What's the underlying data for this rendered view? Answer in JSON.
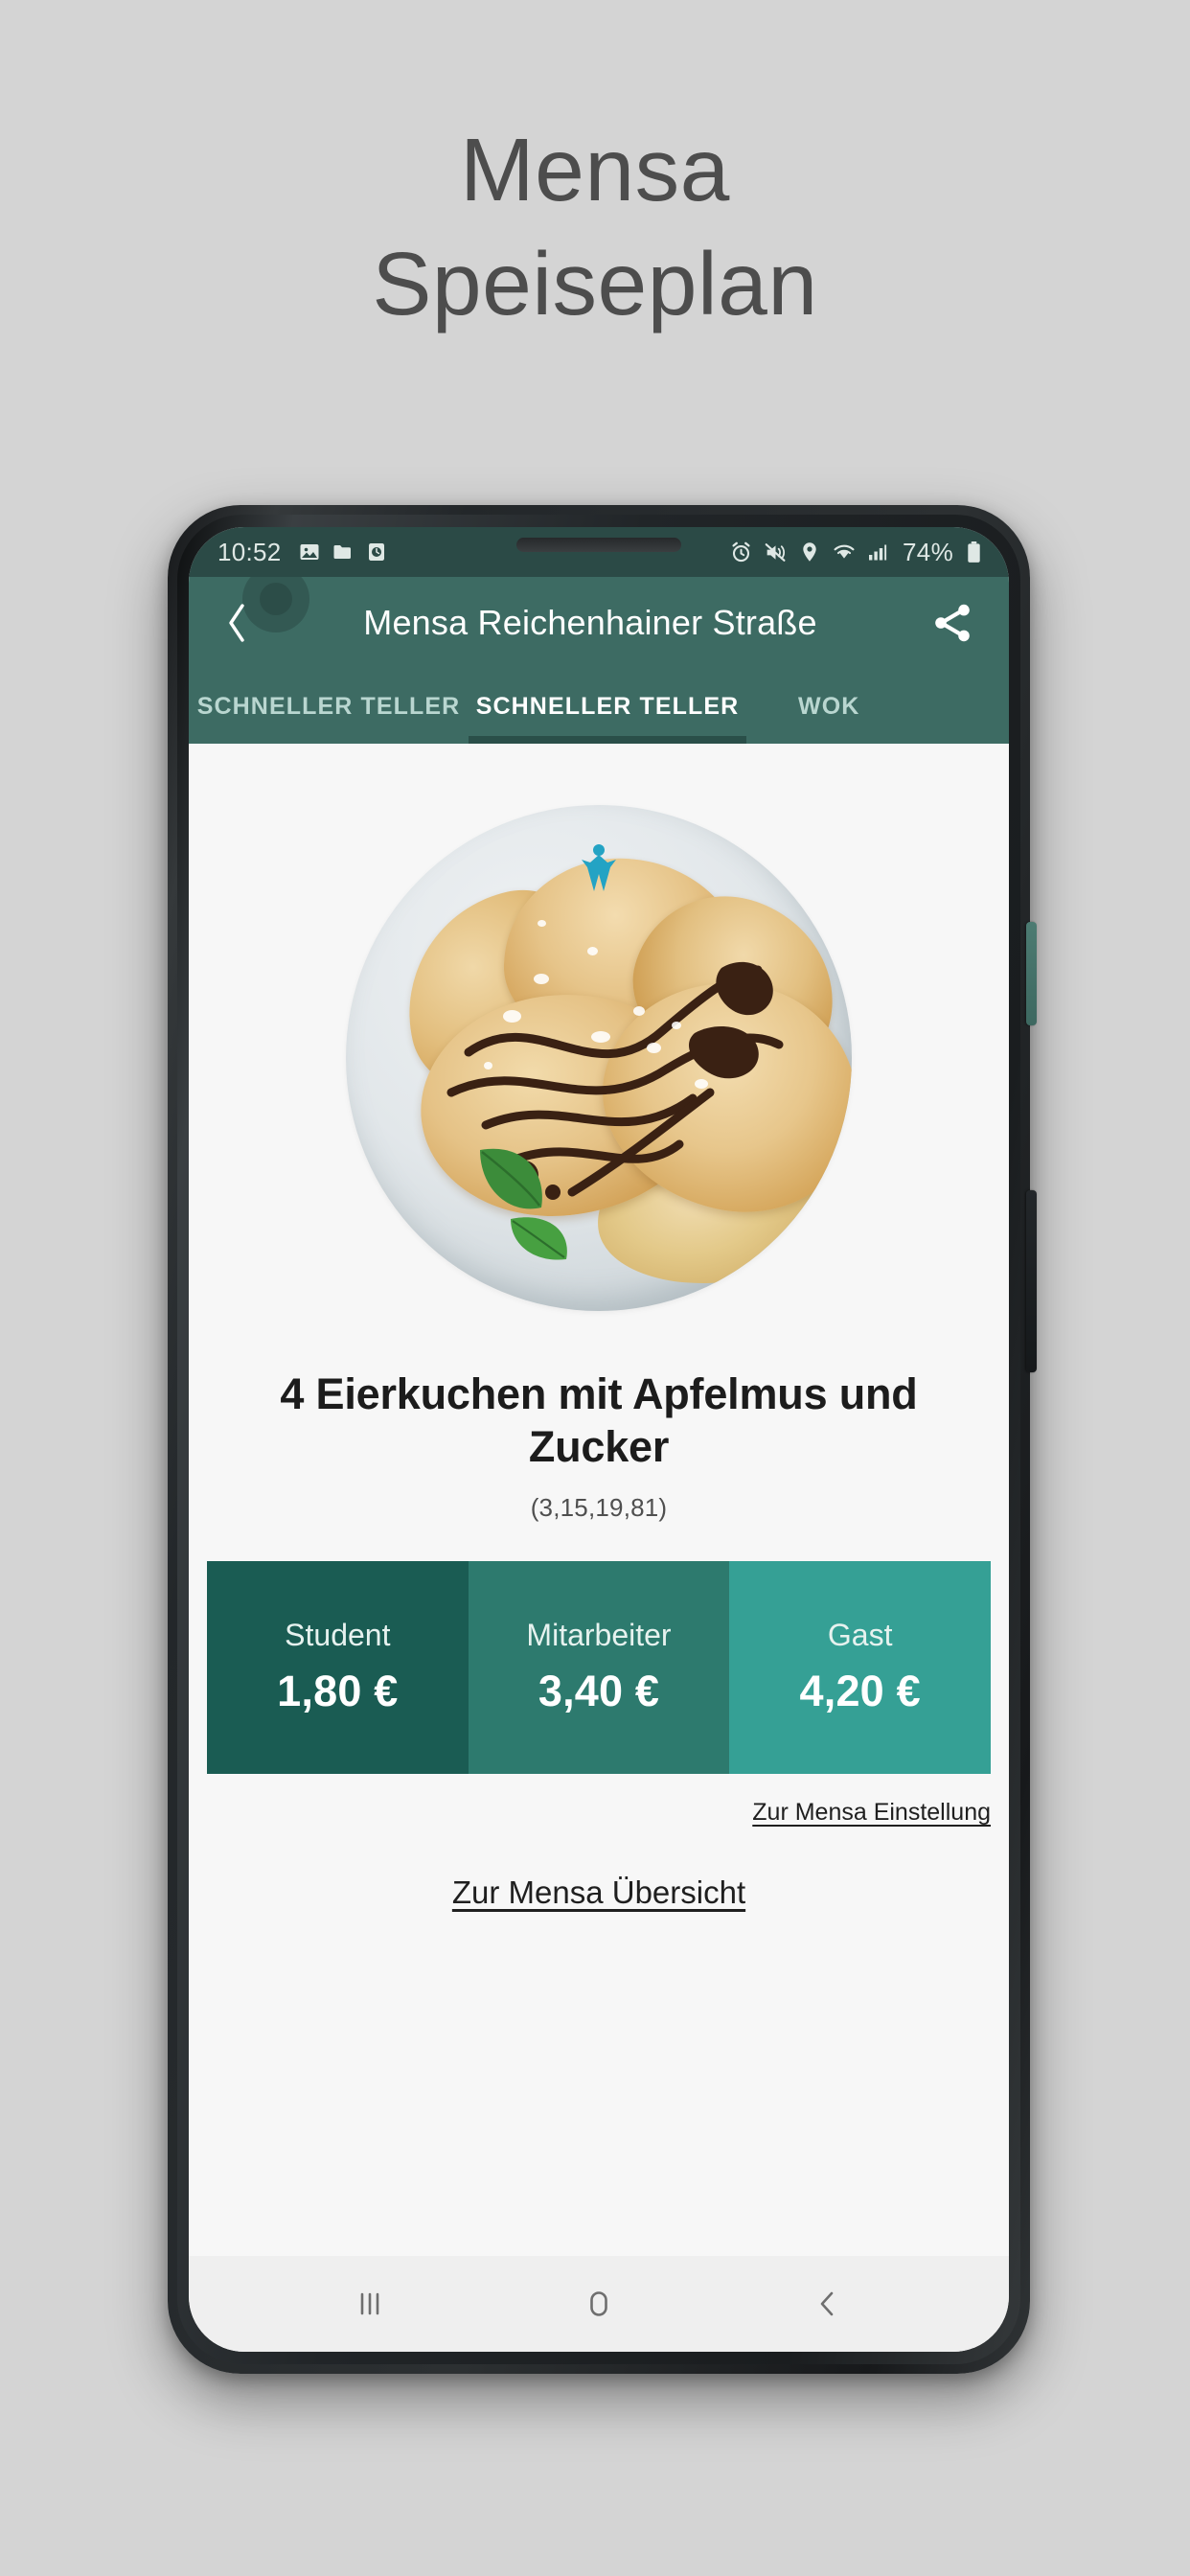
{
  "page": {
    "heading_line1": "Mensa",
    "heading_line2": "Speiseplan",
    "background_color": "#d4d4d4",
    "heading_color": "#4d4d4d"
  },
  "phone": {
    "hardware": {
      "bixby_button": "bixby-button",
      "power_button": "power-button",
      "earpiece": "earpiece-speaker",
      "camera": "front-camera"
    }
  },
  "status_bar": {
    "time": "10:52",
    "battery_percent": "74%",
    "left_icons": [
      "gallery-icon",
      "folder-icon",
      "clock-box-icon"
    ],
    "right_icons": [
      "alarm-icon",
      "mute-vibrate-icon",
      "location-icon",
      "wifi-icon",
      "signal-icon"
    ],
    "background_color": "#2b4a46",
    "text_color": "#dfe8e5"
  },
  "app_bar": {
    "back_label": "back-arrow",
    "title": "Mensa Reichenhainer Straße",
    "share_label": "share",
    "background_color": "#3d6b63",
    "title_color": "#ffffff"
  },
  "tabs": {
    "items": [
      {
        "label": "SCHNELLER TELLER",
        "active": false
      },
      {
        "label": "SCHNELLER TELLER",
        "active": true
      },
      {
        "label": "WOK",
        "active": false
      }
    ],
    "indicator_color": "#2a4f49",
    "active_color": "#ffffff",
    "inactive_color": "#b9d6d0"
  },
  "meal": {
    "photo_alt": "plate-of-pancakes-with-apple-sauce",
    "title": "4 Eierkuchen mit Apfelmus und Zucker",
    "additives": "(3,15,19,81)",
    "prices": [
      {
        "label": "Student",
        "value": "1,80 €",
        "color": "#1a5c53"
      },
      {
        "label": "Mitarbeiter",
        "value": "3,40 €",
        "color": "#2d7a6e"
      },
      {
        "label": "Gast",
        "value": "4,20 €",
        "color": "#35a095"
      }
    ],
    "link_settings": "Zur Mensa Einstellung",
    "link_overview": "Zur Mensa Übersicht",
    "content_background": "#f7f7f7"
  },
  "nav_bar": {
    "recents_label": "recents",
    "home_label": "home",
    "back_label": "back",
    "background_color": "#efefef",
    "icon_color": "#6e6e6e"
  }
}
